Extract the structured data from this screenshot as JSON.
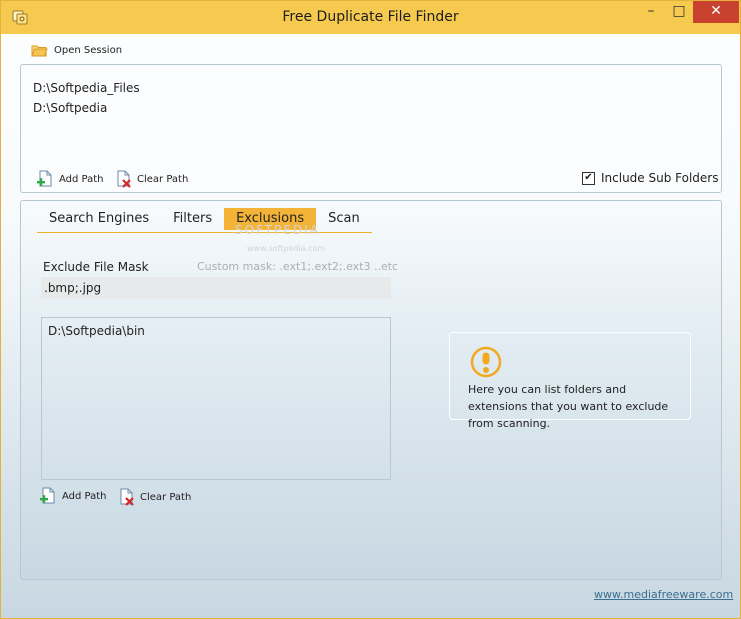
{
  "window": {
    "title": "Free Duplicate File Finder",
    "minimize_glyph": "–",
    "maximize_glyph": "□",
    "close_glyph": "✕"
  },
  "toolbar": {
    "open_session_label": "Open Session",
    "open_session_icon": "folder-open-icon"
  },
  "paths_panel": {
    "paths": [
      "D:\\Softpedia_Files",
      "D:\\Softpedia"
    ],
    "add_path_label": "Add Path",
    "clear_path_label": "Clear Path",
    "include_subfolders_label": "Include Sub Folders",
    "include_subfolders_checked": true,
    "check_glyph": "✔"
  },
  "tabs": [
    {
      "label": "Search Engines",
      "active": false
    },
    {
      "label": "Filters",
      "active": false
    },
    {
      "label": "Exclusions",
      "active": true
    },
    {
      "label": "Scan",
      "active": false
    }
  ],
  "watermark": {
    "text": "SOFTPEDIA",
    "sub": "www.softpedia.com"
  },
  "exclusions": {
    "mask_label": "Exclude File Mask",
    "mask_hint": "Custom mask: .ext1;.ext2;.ext3      ..etc",
    "mask_value": ".bmp;.jpg",
    "folders": [
      "D:\\Softpedia\\bin"
    ],
    "add_path_label": "Add Path",
    "clear_path_label": "Clear Path"
  },
  "info": {
    "text": "Here you can list folders and extensions that you want to exclude from scanning."
  },
  "footer": {
    "link": "www.mediafreeware.com"
  },
  "colors": {
    "accent": "#f2b336",
    "titlebar": "#f6c94f",
    "close": "#c9422f",
    "link": "#3a6f8f"
  }
}
